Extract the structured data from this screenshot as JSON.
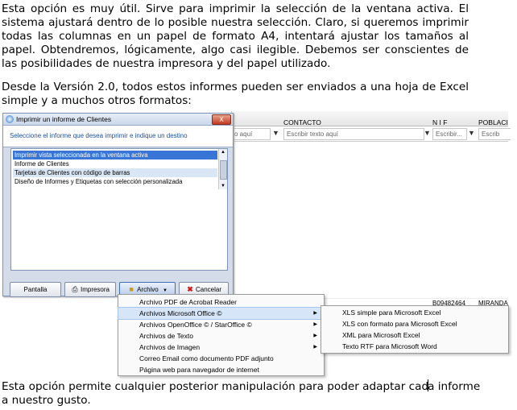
{
  "paragraphs": {
    "p1": "Esta opción es muy útil. Sirve para imprimir la selección de la ventana activa. El sistema ajustará dentro de lo posible nuestra selección. Claro, si queremos imprimir todas las columnas en un papel de formato A4, intentará ajustar los tamaños al papel. Obtendremos, lógicamente, algo casi ilegible. Debemos ser conscientes de las posibilidades de nuestra impresora y del papel utilizado.",
    "p2": "Desde la Versión 2.0, todos estos informes pueden ser enviados a una hoja de Excel simple y a muchos otros formatos:",
    "p3_before_caret": "Esta opción permite cualquier posterior  manipulación para poder adaptar cad",
    "p3_after_caret": "a informe a nuestro gusto."
  },
  "background_app": {
    "columns": [
      "CONTACTO",
      "N I F",
      "POBLACI"
    ],
    "filter_left_partial": "o aquí",
    "filter_contacto": "Escribir texto aquí",
    "filter_nif": "Escribir...",
    "filter_pob": "Escrib",
    "row_nif": "B09482464",
    "row_pob": "MIRANDA"
  },
  "dialog": {
    "title": "Imprimir un informe de Clientes",
    "close_label": "X",
    "instruction": "Seleccione el informe que desea imprimir e indique un destino",
    "items": [
      "Imprimir vista seleccionada en la ventana activa",
      "Informe de Clientes",
      "Tarjetas de Clientes con código de barras",
      "Diseño de Informes y Etiquetas con selección personalizada"
    ],
    "buttons": {
      "pantalla": "Pantalla",
      "impresora": "Impresora",
      "archivo": "Archivo",
      "cancelar": "Cancelar"
    }
  },
  "menu": {
    "items": [
      "Archivo PDF de Acrobat Reader",
      "Archivos Microsoft Office ©",
      "Archivos OpenOffice © / StarOffice ©",
      "Archivos de Texto",
      "Archivos de Imagen",
      "Correo Email como documento PDF adjunto",
      "Página web para navegador de internet"
    ],
    "submenu": [
      "XLS simple para Microsoft Excel",
      "XLS con formato para Microsoft Excel",
      "XML para Microsoft Excel",
      "Texto RTF para Microsoft Word"
    ]
  },
  "colors": {
    "selection": "#3875d7",
    "highlight": "#d6e5f8",
    "instruction_text": "#1f4f9a"
  }
}
